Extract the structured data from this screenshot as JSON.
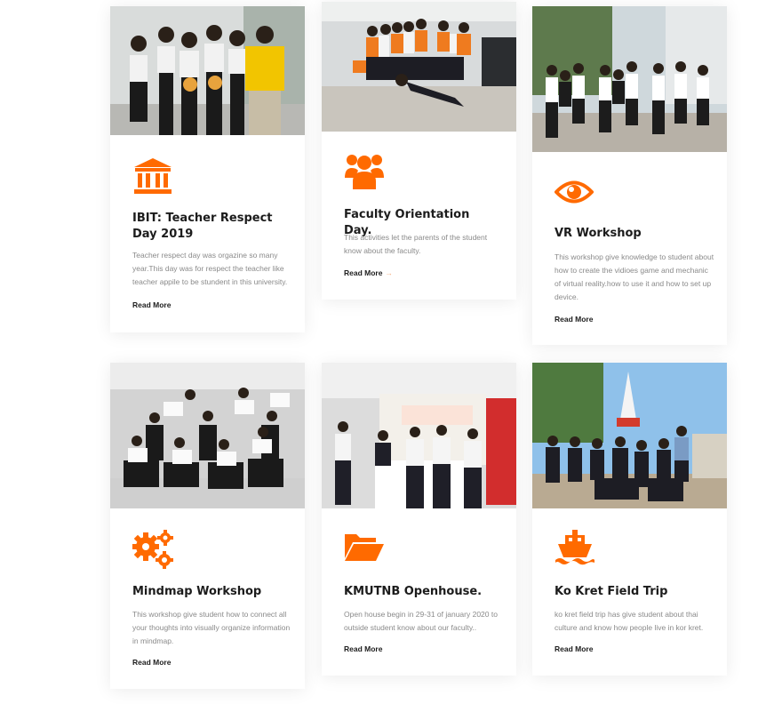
{
  "accent_color": "#ff6a00",
  "cards": [
    {
      "title": "IBIT: Teacher Respect Day 2019",
      "description": "Teacher respect day was orgazine so many year.This day was for respect the teacher like teacher appile to be stundent in this university.",
      "link_label": "Read More",
      "icon": "institution-icon",
      "photo": "group-photo-teacher-respect-day"
    },
    {
      "title": "Faculty Orientation Day.",
      "description": "This activities let the parents of the student know about the faculty.",
      "link_label": "Read More",
      "link_arrow": "→",
      "icon": "users-icon",
      "photo": "group-photo-orientation-day"
    },
    {
      "title": "VR Workshop",
      "description": "This workshop give knowledge to student about how to create the vidioes game and mechanic of virtual reality.how to use it and how to set up device.",
      "link_label": "Read More",
      "icon": "eye-icon",
      "photo": "group-photo-vr-workshop"
    },
    {
      "title": "Mindmap Workshop",
      "description": "This workshop give student how to connect all your thoughts into visually organize information in mindmap.",
      "link_label": "Read More",
      "icon": "gears-icon",
      "photo": "group-photo-mindmap-workshop"
    },
    {
      "title": "KMUTNB Openhouse.",
      "description": "Open house begin in 29-31 of january 2020 to outside student know about our faculty..",
      "link_label": "Read More",
      "icon": "folder-open-icon",
      "photo": "booth-photo-openhouse"
    },
    {
      "title": "Ko Kret Field Trip",
      "description": "ko kret field trip has give student about thai culture and know how people live in kor kret.",
      "link_label": "Read More",
      "icon": "ship-icon",
      "photo": "group-photo-ko-kret-trip"
    }
  ]
}
